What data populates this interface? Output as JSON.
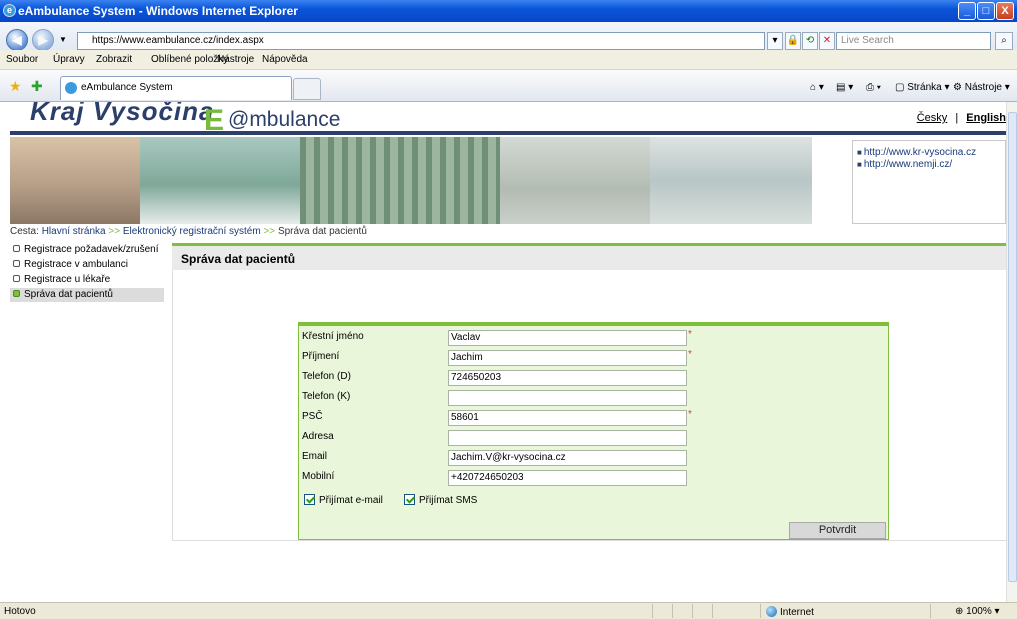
{
  "window": {
    "title": "eAmbulance System - Windows Internet Explorer",
    "controls": [
      "_",
      "□",
      "X"
    ]
  },
  "addressbar": {
    "url": "https://www.eambulance.cz/index.aspx",
    "search_placeholder": "Live Search"
  },
  "menubar": [
    "Soubor",
    "Úpravy",
    "Zobrazit",
    "Oblíbené položky",
    "Nástroje",
    "Nápověda"
  ],
  "tab": {
    "label": "eAmbulance System"
  },
  "commandbar": {
    "page": "Stránka ▾",
    "tools": "Nástroje ▾"
  },
  "header": {
    "region_logo": "Kraj Vysočina",
    "logo_e": "E",
    "logo_rest": "@mbulance",
    "lang_cz": "Česky",
    "lang_sep": "|",
    "lang_en": "English"
  },
  "links": [
    "http://www.kr-vysocina.cz",
    "http://www.nemji.cz/"
  ],
  "breadcrumb": {
    "prefix": "Cesta:",
    "items": [
      "Hlavní stránka",
      "Elektronický registrační systém",
      "Správa dat pacientů"
    ],
    "sep": ">>"
  },
  "sidebar": {
    "items": [
      {
        "label": "Registrace požadavek/zrušení",
        "active": false
      },
      {
        "label": "Registrace v ambulanci",
        "active": false
      },
      {
        "label": "Registrace u lékaře",
        "active": false
      },
      {
        "label": "Správa dat pacientů",
        "active": true
      }
    ]
  },
  "page": {
    "title": "Správa dat pacientů"
  },
  "form": {
    "fields": [
      {
        "label": "Křestní jméno",
        "value": "Vaclav",
        "required": true
      },
      {
        "label": "Příjmení",
        "value": "Jachim",
        "required": true
      },
      {
        "label": "Telefon (D)",
        "value": "724650203",
        "required": false
      },
      {
        "label": "Telefon (K)",
        "value": "",
        "required": false
      },
      {
        "label": "PSČ",
        "value": "58601",
        "required": true
      },
      {
        "label": "Adresa",
        "value": "",
        "required": false
      },
      {
        "label": "Email",
        "value": "Jachim.V@kr-vysocina.cz",
        "required": false
      },
      {
        "label": "Mobilní",
        "value": "+420724650203",
        "required": false
      }
    ],
    "required_mark": "*",
    "check_email": {
      "label": "Přijímat e-mail",
      "checked": true
    },
    "check_sms": {
      "label": "Přijímat SMS",
      "checked": true
    },
    "submit": "Potvrdit"
  },
  "statusbar": {
    "text": "Hotovo",
    "zone": "Internet",
    "zoom": "100%"
  },
  "colors": {
    "accent_green": "#7ebf3c",
    "brand_navy": "#2c3e6a",
    "form_bg": "#eaf6da"
  }
}
